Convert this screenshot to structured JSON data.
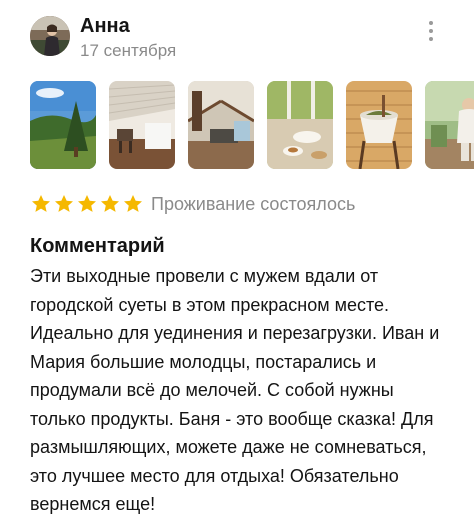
{
  "review": {
    "author": "Анна",
    "date": "17 сентября",
    "rating": 5,
    "rating_max": 5,
    "stay_status": "Проживание состоялось",
    "comment_title": "Комментарий",
    "comment_text": "Эти выходные провели с мужем вдали от городской суеты в этом прекрасном месте. Идеально для уединения и перезагрузки. Иван и Мария большие молодцы, постарались и продумали всё до мелочей. С собой нужны только продукты. Баня - это вообще сказка! Для размышляющих, можете даже не сомневаться, это лучшее место для отдыха! Обязательно вернемся еще!"
  },
  "icons": {
    "menu": "more-vertical-icon",
    "star": "star-icon"
  },
  "colors": {
    "star": "#f5b800",
    "secondary_text": "#8a8a8a",
    "primary_text": "#141414",
    "background": "#ffffff"
  }
}
